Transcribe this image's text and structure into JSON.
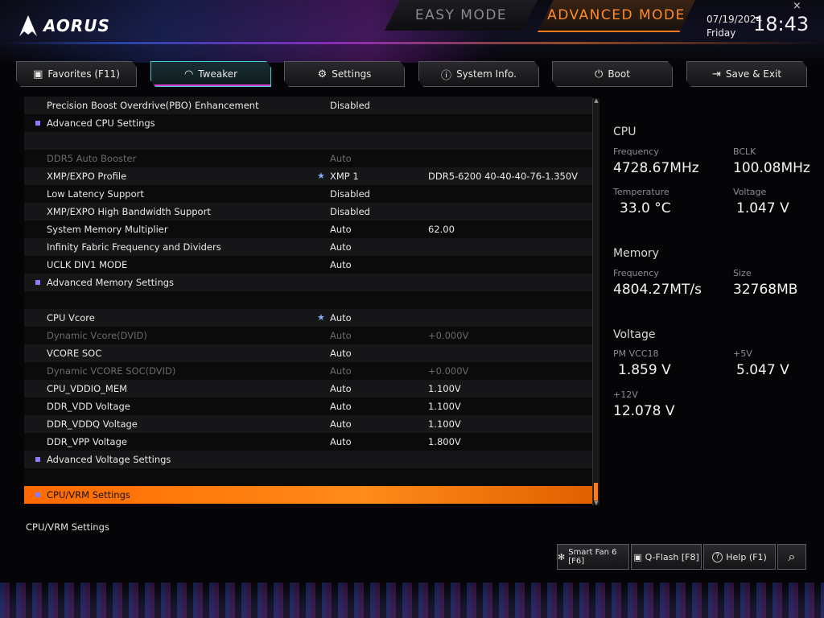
{
  "header": {
    "brand": "AORUS",
    "easy_mode": "EASY MODE",
    "advanced_mode": "ADVANCED MODE",
    "date": "07/19/2024",
    "day": "Friday",
    "time": "18:43",
    "close_glyph": "×",
    "accent_color": "#ff7a1a"
  },
  "tabs": [
    {
      "icon": "favorites-icon",
      "glyph": "▣",
      "label": "Favorites (F11)"
    },
    {
      "icon": "gauge-icon",
      "glyph": "◠",
      "label": "Tweaker"
    },
    {
      "icon": "gear-icon",
      "glyph": "⚙",
      "label": "Settings"
    },
    {
      "icon": "info-icon",
      "glyph": "ⓘ",
      "label": "System Info."
    },
    {
      "icon": "power-icon",
      "glyph": "⏻",
      "label": "Boot"
    },
    {
      "icon": "exit-icon",
      "glyph": "⇥",
      "label": "Save & Exit"
    }
  ],
  "settings": [
    {
      "name": "Precision Boost Overdrive(PBO) Enhancement",
      "v1": "Disabled",
      "v2": "",
      "dim": false,
      "sub": false,
      "star": false
    },
    {
      "name": "Advanced CPU Settings",
      "v1": "",
      "v2": "",
      "dim": false,
      "sub": true,
      "star": false
    },
    {
      "name": "",
      "v1": "",
      "v2": "",
      "dim": false,
      "sub": false,
      "star": false
    },
    {
      "name": "DDR5 Auto Booster",
      "v1": "Auto",
      "v2": "",
      "dim": true,
      "sub": false,
      "star": false
    },
    {
      "name": "XMP/EXPO Profile",
      "v1": "XMP 1",
      "v2": "DDR5-6200 40-40-40-76-1.350V",
      "dim": false,
      "sub": false,
      "star": true
    },
    {
      "name": "Low Latency Support",
      "v1": "Disabled",
      "v2": "",
      "dim": false,
      "sub": false,
      "star": false
    },
    {
      "name": "XMP/EXPO High Bandwidth Support",
      "v1": "Disabled",
      "v2": "",
      "dim": false,
      "sub": false,
      "star": false
    },
    {
      "name": "System Memory Multiplier",
      "v1": "Auto",
      "v2": "62.00",
      "dim": false,
      "sub": false,
      "star": false
    },
    {
      "name": "Infinity Fabric Frequency and Dividers",
      "v1": "Auto",
      "v2": "",
      "dim": false,
      "sub": false,
      "star": false
    },
    {
      "name": "UCLK DIV1 MODE",
      "v1": "Auto",
      "v2": "",
      "dim": false,
      "sub": false,
      "star": false
    },
    {
      "name": "Advanced Memory Settings",
      "v1": "",
      "v2": "",
      "dim": false,
      "sub": true,
      "star": false
    },
    {
      "name": "",
      "v1": "",
      "v2": "",
      "dim": false,
      "sub": false,
      "star": false
    },
    {
      "name": "CPU Vcore",
      "v1": "Auto",
      "v2": "",
      "dim": false,
      "sub": false,
      "star": true
    },
    {
      "name": "Dynamic Vcore(DVID)",
      "v1": "Auto",
      "v2": "+0.000V",
      "dim": true,
      "sub": false,
      "star": false
    },
    {
      "name": "VCORE SOC",
      "v1": "Auto",
      "v2": "",
      "dim": false,
      "sub": false,
      "star": false
    },
    {
      "name": "Dynamic VCORE SOC(DVID)",
      "v1": "Auto",
      "v2": "+0.000V",
      "dim": true,
      "sub": false,
      "star": false
    },
    {
      "name": "CPU_VDDIO_MEM",
      "v1": "Auto",
      "v2": "1.100V",
      "dim": false,
      "sub": false,
      "star": false
    },
    {
      "name": "DDR_VDD Voltage",
      "v1": "Auto",
      "v2": "1.100V",
      "dim": false,
      "sub": false,
      "star": false
    },
    {
      "name": "DDR_VDDQ Voltage",
      "v1": "Auto",
      "v2": "1.100V",
      "dim": false,
      "sub": false,
      "star": false
    },
    {
      "name": "DDR_VPP Voltage",
      "v1": "Auto",
      "v2": "1.800V",
      "dim": false,
      "sub": false,
      "star": false
    },
    {
      "name": "Advanced Voltage Settings",
      "v1": "",
      "v2": "",
      "dim": false,
      "sub": true,
      "star": false
    },
    {
      "name": "",
      "v1": "",
      "v2": "",
      "dim": false,
      "sub": false,
      "star": false
    },
    {
      "name": "CPU/VRM Settings",
      "v1": "",
      "v2": "",
      "dim": false,
      "sub": true,
      "star": false,
      "selected": true
    }
  ],
  "help_text": "CPU/VRM Settings",
  "star_glyph": "★",
  "info": {
    "cpu": {
      "title": "CPU",
      "freq_label": "Frequency",
      "freq": "4728.67MHz",
      "bclk_label": "BCLK",
      "bclk": "100.08MHz",
      "temp_label": "Temperature",
      "temp": "33.0 °C",
      "volt_label": "Voltage",
      "volt": "1.047 V"
    },
    "memory": {
      "title": "Memory",
      "freq_label": "Frequency",
      "freq": "4804.27MT/s",
      "size_label": "Size",
      "size": "32768MB"
    },
    "voltage": {
      "title": "Voltage",
      "vcc18_label": "PM VCC18",
      "vcc18": "1.859 V",
      "p5v_label": "+5V",
      "p5v": "5.047 V",
      "p12v_label": "+12V",
      "p12v": "12.078 V"
    }
  },
  "bottom": {
    "smartfan": {
      "glyph": "✻",
      "label": "Smart Fan 6 [F6]"
    },
    "qflash": {
      "glyph": "▣",
      "label": "Q-Flash [F8]"
    },
    "help": {
      "glyph": "?",
      "label": "Help (F1)"
    },
    "search": {
      "glyph": "⌕"
    }
  }
}
